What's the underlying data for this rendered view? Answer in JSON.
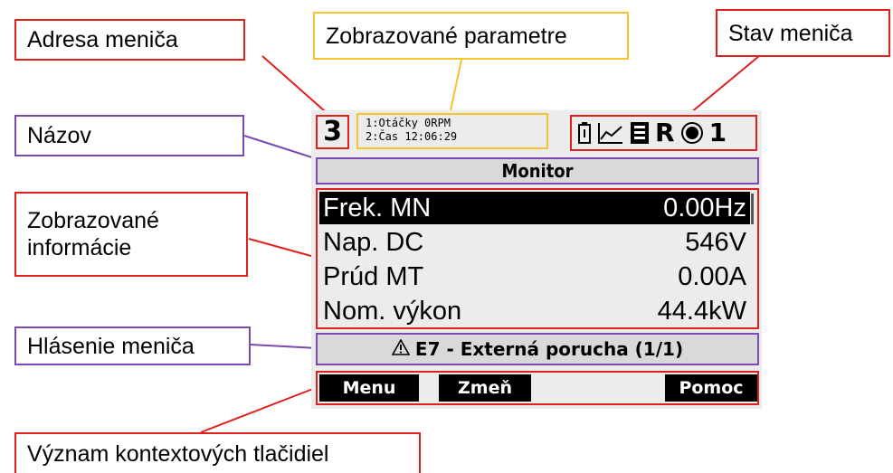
{
  "callouts": {
    "address": "Adresa meniča",
    "params": "Zobrazované parametre",
    "status": "Stav meniča",
    "title": "Názov",
    "info_line1": "Zobrazované",
    "info_line2": "informácie",
    "message": "Hlásenie meniča",
    "softkeys": "Význam kontextových tlačidiel"
  },
  "display": {
    "address": "3",
    "params": [
      "1:Otáčky 0RPM",
      "2:Čas 12:06:29"
    ],
    "status_icons": [
      "battery-icon",
      "graph-icon",
      "local-icon"
    ],
    "status_letter": "R",
    "status_run_icon": "stop-circle-icon",
    "status_number": "1",
    "title": "Monitor",
    "rows": [
      {
        "label": "Frek. MN",
        "value": "0.00Hz",
        "selected": true
      },
      {
        "label": "Nap. DC",
        "value": "546V"
      },
      {
        "label": "Prúd MT",
        "value": "0.00A"
      },
      {
        "label": "Nom. výkon",
        "value": "44.4kW"
      }
    ],
    "message": "E7 - Externá porucha (1/1)",
    "softkeys": [
      "Menu",
      "Zmeň",
      "Pomoc"
    ]
  },
  "colors": {
    "red": "#e0201d",
    "gold": "#f4c430",
    "purple": "#7a4ab0",
    "lcd": "#ececec"
  }
}
